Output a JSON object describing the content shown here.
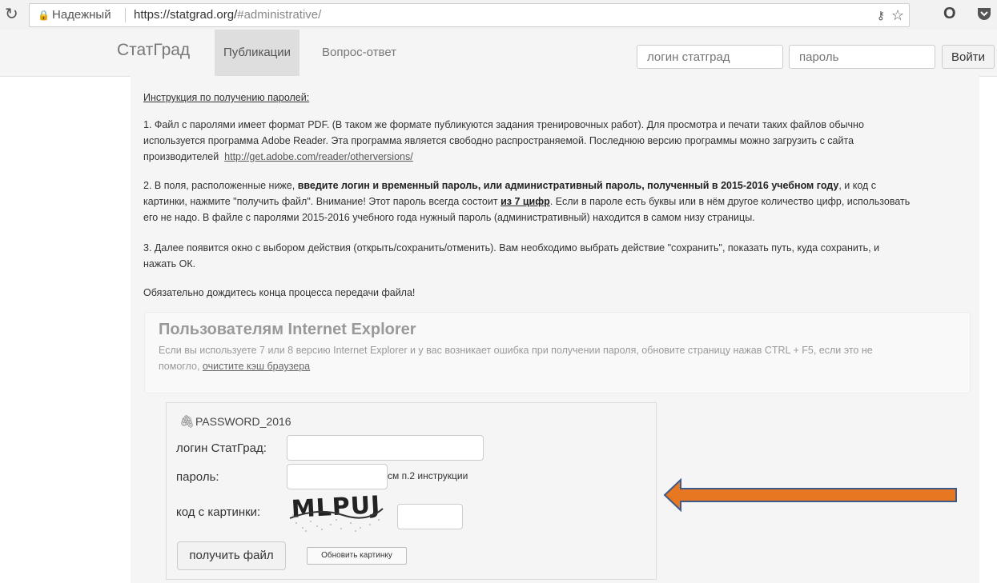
{
  "browser": {
    "secure_label": "Надежный",
    "url_main": "https://statgrad.org/",
    "url_tail": "#administrative/"
  },
  "nav": {
    "brand": "СтатГрад",
    "items": [
      {
        "label": "Публикации"
      },
      {
        "label": "Вопрос-ответ"
      }
    ],
    "login_placeholder": "логин статград",
    "password_placeholder": "пароль",
    "login_button": "Войти"
  },
  "instructions": {
    "heading": "Инструкция по получению паролей:",
    "p1_line1": "1. Файл с паролями имеет формат PDF. (В таком же формате публикуются задания тренировочных работ). Для просмотра и печати таких файлов обычно",
    "p1_line2": "используется программа Adobe Reader. Эта программа является свободно распространяемой. Последнюю версию программы можно загрузить с сайта",
    "p1_line3": "производителей",
    "p1_link": "http://get.adobe.com/reader/otherversions/",
    "p2_a": "2.  В поля, расположенные ниже, ",
    "p2_bold": "введите логин и временный пароль, или административный пароль, полученный в 2015-2016 учебном году",
    "p2_b": ", и код с",
    "p2_line2a": "картинки, нажмите \"получить файл\". Внимание! Этот пароль всегда состоит ",
    "p2_line2bold": "из 7 цифр",
    "p2_line2b": ". Если в пароле есть буквы или в нём другое количество цифр, использовать",
    "p2_line3": "его не надо. В файле с паролями 2015-2016 учебного года нужный пароль (административный) находится в самом низу страницы.",
    "p3_line1": "3. Далее появится окно с выбором действия (открыть/сохранить/отменить). Вам необходимо выбрать действие \"сохранить\", показать путь, куда сохранить, и",
    "p3_line2": "нажать ОК.",
    "p4": "Обязательно дождитесь конца процесса передачи файла!"
  },
  "ie_notice": {
    "title": "Пользователям Internet Explorer",
    "text": "Если вы используете 7 или 8 версию Internet Explorer и у вас возникает ошибка при получении пароля, обновите страницу нажав CTRL + F5, если это не",
    "text2": "помогло, ",
    "link": "очистите кэш браузера"
  },
  "form": {
    "file_name": "PASSWORD_2016",
    "login_label": "логин СтатГрад:",
    "password_label": "пароль:",
    "password_hint": "см п.2 инструкции",
    "captcha_label": "код с картинки:",
    "captcha_text": "MLPUJ",
    "get_button": "получить файл",
    "refresh_button": "Обновить картинку"
  },
  "colors": {
    "arrow_fill": "#e87722",
    "arrow_stroke": "#3c5a8a"
  }
}
